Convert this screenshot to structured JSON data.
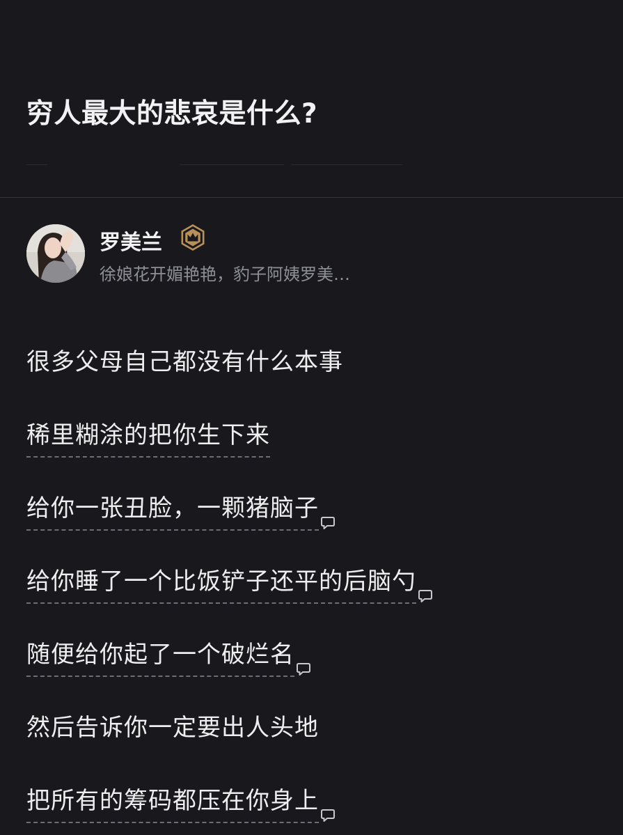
{
  "question": {
    "title": "穷人最大的悲哀是什么?"
  },
  "author": {
    "name": "罗美兰",
    "badge_icon": "crown-badge-icon",
    "bio": "徐娘花开媚艳艳，豹子阿姨罗美…"
  },
  "answer": {
    "lines": [
      {
        "text": "很多父母自己都没有什么本事",
        "underlined": false,
        "comment_icon": false
      },
      {
        "text": "稀里糊涂的把你生下来",
        "underlined": true,
        "comment_icon": false
      },
      {
        "text": "给你一张丑脸，一颗猪脑子",
        "underlined": true,
        "comment_icon": true
      },
      {
        "text": "给你睡了一个比饭铲子还平的后脑勺",
        "underlined": true,
        "comment_icon": true
      },
      {
        "text": "随便给你起了一个破烂名",
        "underlined": true,
        "comment_icon": true
      },
      {
        "text": "然后告诉你一定要出人头地",
        "underlined": false,
        "comment_icon": false
      },
      {
        "text": "把所有的筹码都压在你身上",
        "underlined": true,
        "comment_icon": true
      }
    ]
  },
  "colors": {
    "background": "#19191d",
    "text_primary": "#eeeef0",
    "text_secondary": "#8e8e96",
    "badge_gold": "#b8915a",
    "divider": "#34343a"
  }
}
